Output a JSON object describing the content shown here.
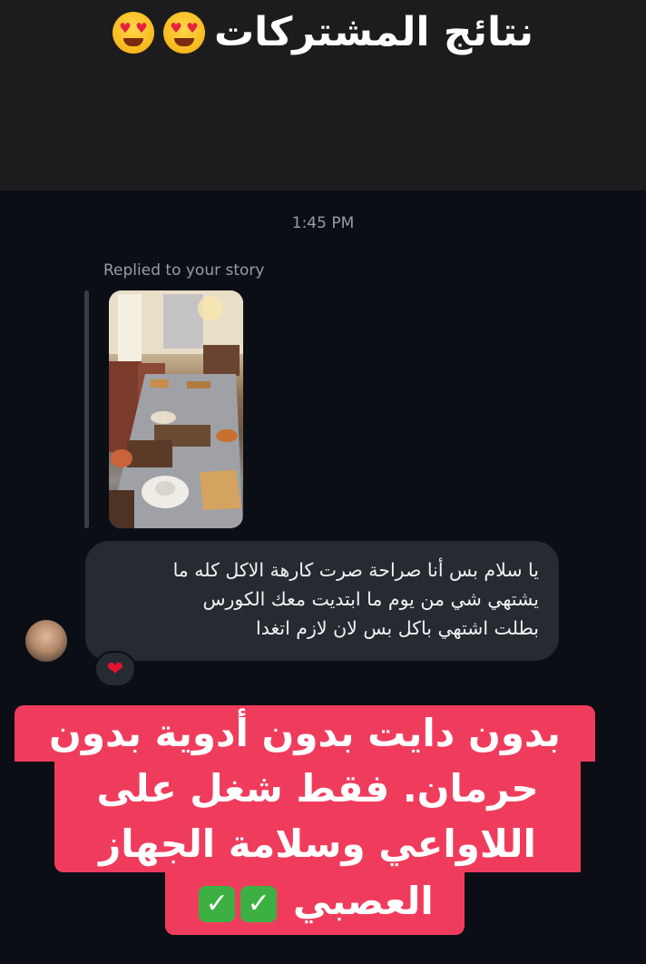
{
  "header": {
    "title": "نتائج المشتركات",
    "emoji": "heart-eyes-emoji"
  },
  "chat": {
    "timestamp": "1:45 PM",
    "replied_label": "Replied to your story",
    "message_lines": [
      "يا سلام بس أنا صراحة صرت كارهة الاكل كله ما",
      "يشتهي شي من يوم ما ابتديت معك الكورس",
      "بطلت اشتهي باكل بس لان لازم اتغدا"
    ],
    "reaction": "❤"
  },
  "banner": {
    "lines": [
      "بدون دايت بدون أدوية بدون",
      "حرمان. فقط شغل على",
      "اللاواعي وسلامة الجهاز",
      "العصبي"
    ],
    "check_icon": "✓",
    "color": "#f03c5c"
  }
}
